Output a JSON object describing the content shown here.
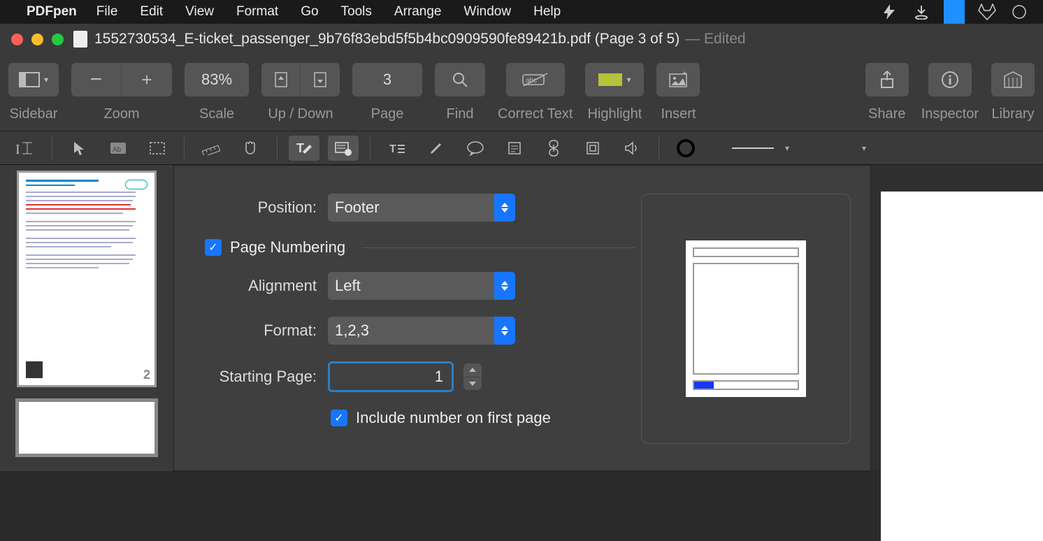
{
  "menubar": {
    "app": "PDFpen",
    "items": [
      "File",
      "Edit",
      "View",
      "Format",
      "Go",
      "Tools",
      "Arrange",
      "Window",
      "Help"
    ]
  },
  "titlebar": {
    "filename": "1552730534_E-ticket_passenger_9b76f83ebd5f5b4bc0909590fe89421b.pdf (Page 3 of 5)",
    "status": "— Edited"
  },
  "toolbar": {
    "sidebar": "Sidebar",
    "zoom": "Zoom",
    "scale": "Scale",
    "scale_value": "83%",
    "updown": "Up / Down",
    "page": "Page",
    "page_value": "3",
    "find": "Find",
    "correct": "Correct Text",
    "highlight": "Highlight",
    "insert": "Insert",
    "share": "Share",
    "inspector": "Inspector",
    "library": "Library"
  },
  "thumbs": {
    "page2_num": "2"
  },
  "dialog": {
    "position_label": "Position:",
    "position_value": "Footer",
    "checkbox_page_numbering": "Page Numbering",
    "alignment_label": "Alignment",
    "alignment_value": "Left",
    "format_label": "Format:",
    "format_value": "1,2,3",
    "starting_page_label": "Starting Page:",
    "starting_page_value": "1",
    "include_first": "Include number on first page"
  }
}
